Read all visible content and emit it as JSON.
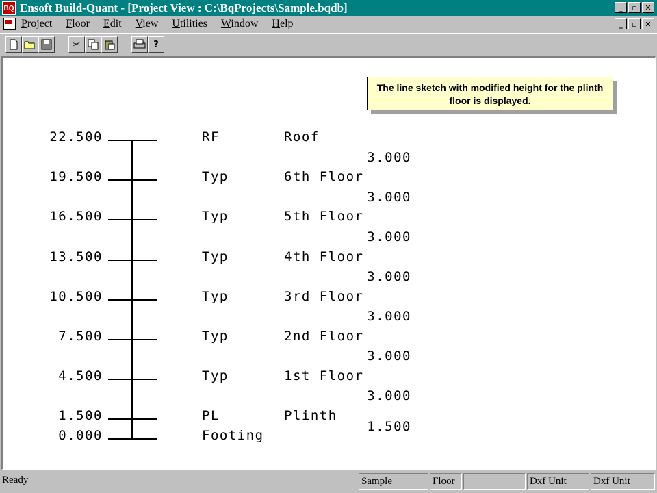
{
  "window": {
    "title": "Ensoft Build-Quant - [Project View : C:\\BqProjects\\Sample.bqdb]",
    "app_icon_text": "BQ",
    "controls": [
      "_",
      "▫",
      "✕"
    ]
  },
  "menu": {
    "items": [
      {
        "accel": "P",
        "rest": "roject"
      },
      {
        "accel": "F",
        "rest": "loor"
      },
      {
        "accel": "E",
        "rest": "dit"
      },
      {
        "accel": "V",
        "rest": "iew"
      },
      {
        "accel": "U",
        "rest": "tilities"
      },
      {
        "accel": "W",
        "rest": "indow"
      },
      {
        "accel": "H",
        "rest": "elp"
      }
    ]
  },
  "toolbar": {
    "buttons": [
      "new-file",
      "open-folder",
      "save",
      "cut",
      "copy",
      "paste",
      "print",
      "help"
    ]
  },
  "callout": {
    "text": "The line sketch with modified height for the plinth floor is displayed."
  },
  "sketch": {
    "levels": [
      {
        "elevation": "22.500",
        "type": "RF",
        "name": "Roof"
      },
      {
        "elevation": "19.500",
        "type": "Typ",
        "name": "6th Floor"
      },
      {
        "elevation": "16.500",
        "type": "Typ",
        "name": "5th Floor"
      },
      {
        "elevation": "13.500",
        "type": "Typ",
        "name": "4th Floor"
      },
      {
        "elevation": "10.500",
        "type": "Typ",
        "name": "3rd Floor"
      },
      {
        "elevation": "7.500",
        "type": "Typ",
        "name": "2nd Floor"
      },
      {
        "elevation": "4.500",
        "type": "Typ",
        "name": "1st Floor"
      },
      {
        "elevation": "1.500",
        "type": "PL",
        "name": "Plinth"
      },
      {
        "elevation": "0.000",
        "type": "Footing",
        "name": ""
      }
    ],
    "heights": [
      "3.000",
      "3.000",
      "3.000",
      "3.000",
      "3.000",
      "3.000",
      "3.000",
      "1.500"
    ]
  },
  "status": {
    "ready": "Ready",
    "panels": [
      "Sample",
      "Floor",
      "",
      "Dxf Unit",
      "Dxf Unit"
    ]
  }
}
